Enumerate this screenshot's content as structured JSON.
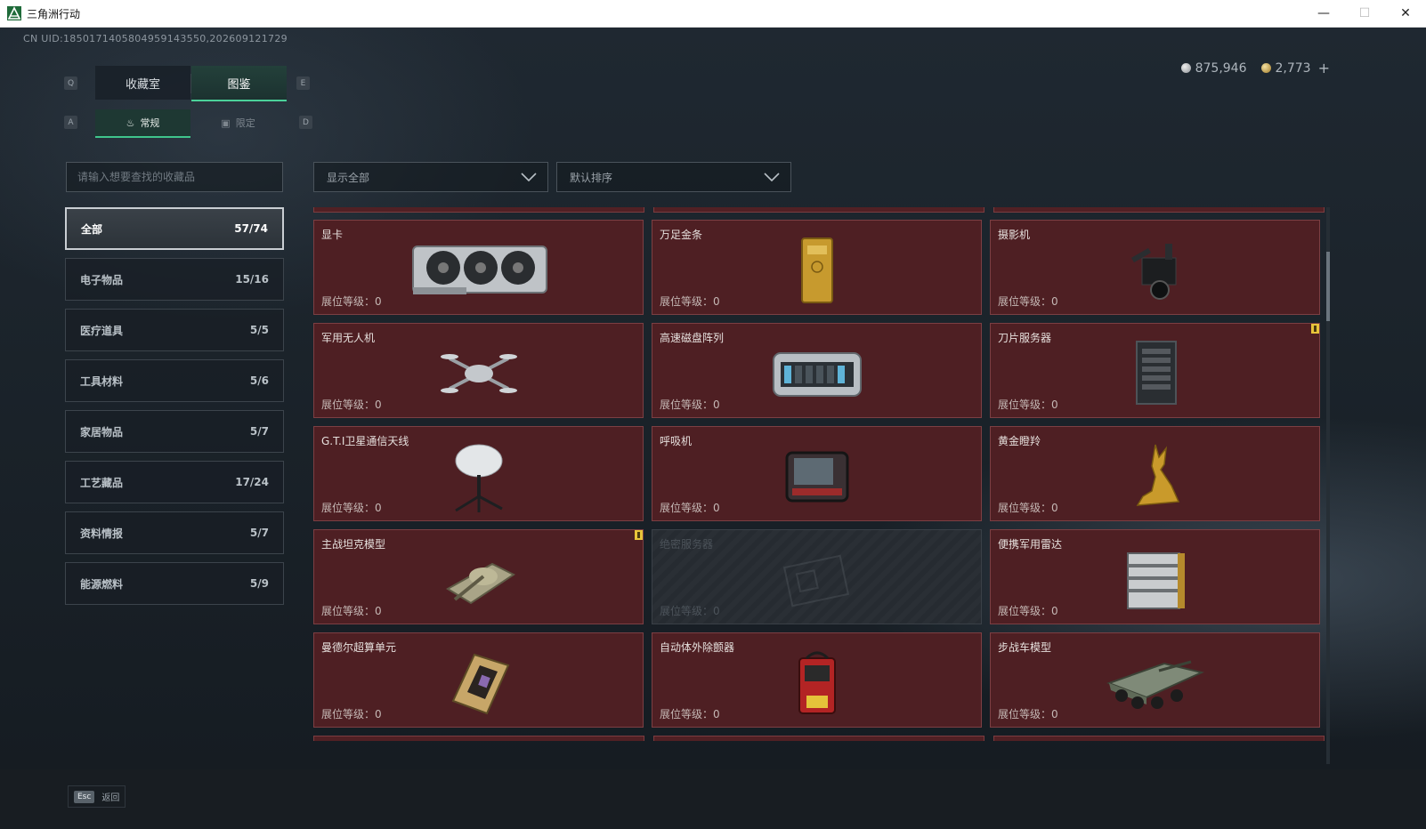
{
  "window": {
    "title": "三角洲行动",
    "minimize": "—",
    "maximize": "☐",
    "close": "✕"
  },
  "uid": "CN UID:1850171405804959143550,202609121729",
  "currency": {
    "silver": "875,946",
    "gold": "2,773",
    "add": "+"
  },
  "keys": {
    "q": "Q",
    "e": "E",
    "a": "A",
    "d": "D"
  },
  "tabs": [
    {
      "label": "收藏室"
    },
    {
      "label": "图鉴"
    }
  ],
  "subtabs": [
    {
      "label": "常规"
    },
    {
      "label": "限定"
    }
  ],
  "search": {
    "placeholder": "请输入想要查找的收藏品"
  },
  "filters": {
    "display": "显示全部",
    "sort": "默认排序"
  },
  "categories": [
    {
      "label": "全部",
      "count": "57/74"
    },
    {
      "label": "电子物品",
      "count": "15/16"
    },
    {
      "label": "医疗道具",
      "count": "5/5"
    },
    {
      "label": "工具材料",
      "count": "5/6"
    },
    {
      "label": "家居物品",
      "count": "5/7"
    },
    {
      "label": "工艺藏品",
      "count": "17/24"
    },
    {
      "label": "资料情报",
      "count": "5/7"
    },
    {
      "label": "能源燃料",
      "count": "5/9"
    }
  ],
  "items": [
    {
      "name": "显卡",
      "level": "展位等级：0",
      "icon": "graphics-card-icon"
    },
    {
      "name": "万足金条",
      "level": "展位等级：0",
      "icon": "gold-bar-icon"
    },
    {
      "name": "摄影机",
      "level": "展位等级：0",
      "icon": "camera-icon"
    },
    {
      "name": "军用无人机",
      "level": "展位等级：0",
      "icon": "drone-icon"
    },
    {
      "name": "高速磁盘阵列",
      "level": "展位等级：0",
      "icon": "disk-array-icon"
    },
    {
      "name": "刀片服务器",
      "level": "展位等级：0",
      "icon": "blade-server-icon"
    },
    {
      "name": "G.T.I卫星通信天线",
      "level": "展位等级：0",
      "icon": "satellite-antenna-icon"
    },
    {
      "name": "呼吸机",
      "level": "展位等级：0",
      "icon": "ventilator-icon"
    },
    {
      "name": "黄金瞪羚",
      "level": "展位等级：0",
      "icon": "golden-gazelle-icon"
    },
    {
      "name": "主战坦克模型",
      "level": "展位等级：0",
      "icon": "tank-model-icon"
    },
    {
      "name": "绝密服务器",
      "level": "展位等级：0",
      "icon": "secret-server-icon"
    },
    {
      "name": "便携军用雷达",
      "level": "展位等级：0",
      "icon": "radar-icon"
    },
    {
      "name": "曼德尔超算单元",
      "level": "展位等级：0",
      "icon": "supercomputer-unit-icon"
    },
    {
      "name": "自动体外除颤器",
      "level": "展位等级：0",
      "icon": "defibrillator-icon"
    },
    {
      "name": "步战车模型",
      "level": "展位等级：0",
      "icon": "ifv-model-icon"
    }
  ],
  "footer": {
    "esc_key": "Esc",
    "back": "返回"
  }
}
